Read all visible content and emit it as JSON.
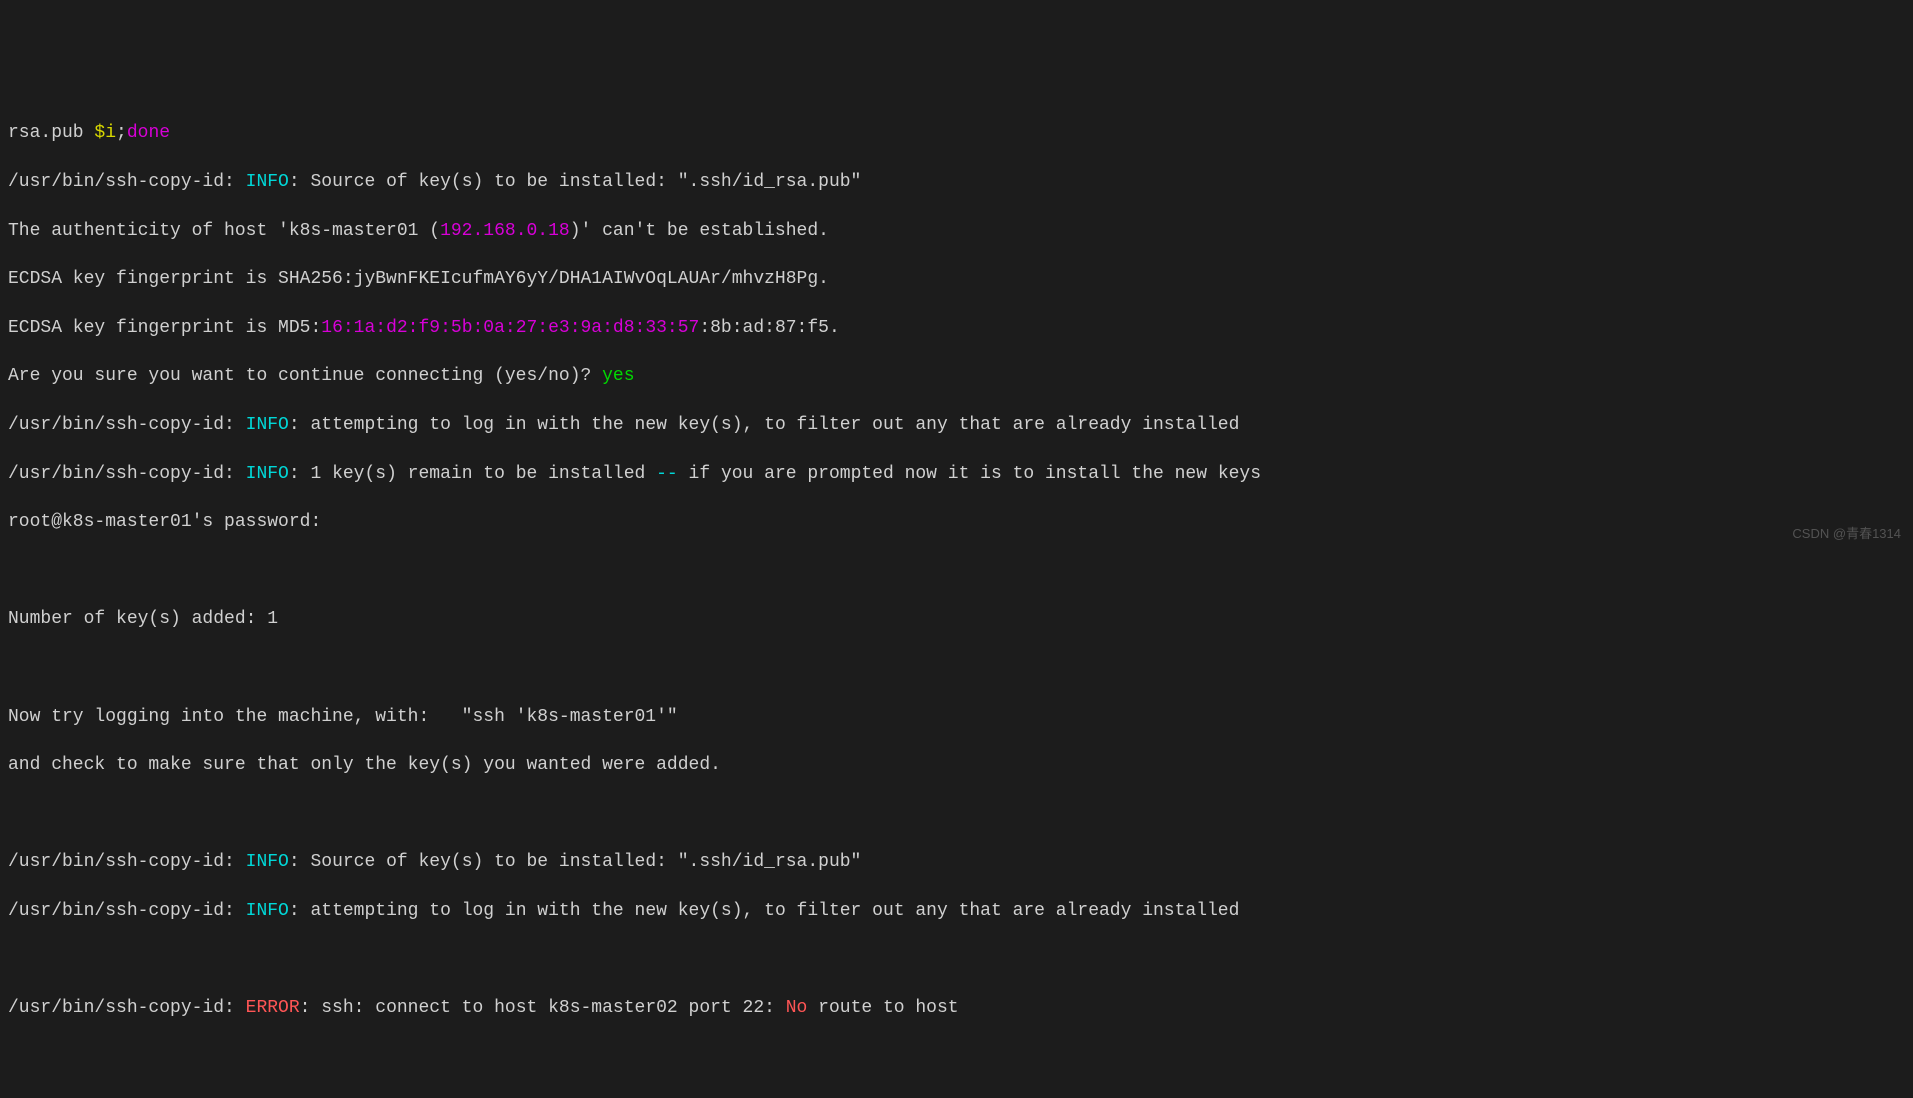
{
  "line_top_partial": {
    "prefix": "rsa.pub ",
    "dollar": "$i",
    "semi": ";",
    "done": "done"
  },
  "lines": [
    {
      "cmd": "/usr/bin/ssh-copy-id: ",
      "info": "INFO",
      "post_info": ": Source of key(s) to be installed: \".ssh/id_rsa.pub\""
    },
    {
      "pre": "The authenticity of host 'k8s-master01 (",
      "ip": "192.168.0.18",
      "post": ")' can't be established."
    },
    {
      "text": "ECDSA key fingerprint is SHA256:jyBwnFKEIcufmAY6yY/DHA1AIWvOqLAUAr/mhvzH8Pg."
    },
    {
      "pre": "ECDSA key fingerprint is MD5:",
      "md5": "16:1a:d2:f9:5b:0a:27:e3:9a:d8:33:57",
      "post": ":8b:ad:87:f5."
    },
    {
      "pre": "Are you sure you want to continue connecting (yes/no)? ",
      "yes": "yes"
    },
    {
      "cmd": "/usr/bin/ssh-copy-id: ",
      "info": "INFO",
      "post_info": ": attempting to log in with the new key(s), to filter out any that are already installed"
    },
    {
      "cmd": "/usr/bin/ssh-copy-id: ",
      "info": "INFO",
      "post_info": ": 1 key(s) remain to be installed ",
      "dashes": "--",
      "tail": " if you are prompted now it is to install the new keys"
    },
    {
      "text": "root@k8s-master01's password:"
    },
    {
      "text": ""
    },
    {
      "text": "Number of key(s) added: 1"
    },
    {
      "text": ""
    },
    {
      "text": "Now try logging into the machine, with:   \"ssh 'k8s-master01'\""
    },
    {
      "text": "and check to make sure that only the key(s) you wanted were added."
    },
    {
      "text": ""
    },
    {
      "cmd": "/usr/bin/ssh-copy-id: ",
      "info": "INFO",
      "post_info": ": Source of key(s) to be installed: \".ssh/id_rsa.pub\""
    },
    {
      "cmd": "/usr/bin/ssh-copy-id: ",
      "info": "INFO",
      "post_info": ": attempting to log in with the new key(s), to filter out any that are already installed"
    },
    {
      "text": ""
    }
  ],
  "error_line": {
    "cmd": "/usr/bin/ssh-copy-id: ",
    "error": "ERROR",
    "mid": ": ssh: connect to host k8s-master02 port 22: ",
    "no": "No",
    "tail": " route to host"
  },
  "watermark": "CSDN @青春1314"
}
